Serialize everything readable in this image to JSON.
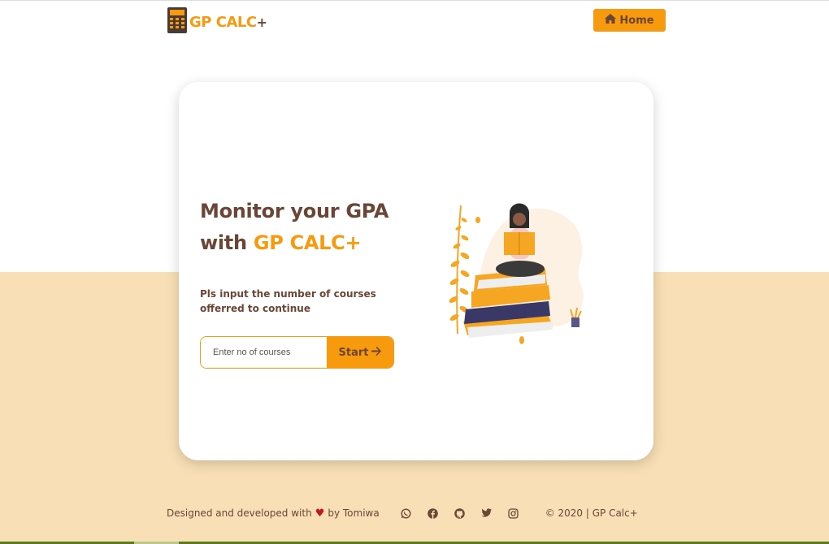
{
  "header": {
    "logo_text": "GP CALC",
    "logo_plus": "+",
    "home_label": "Home"
  },
  "hero": {
    "headline_line1": "Monitor your GPA",
    "headline_with": "with ",
    "headline_brand": "GP CALC+",
    "instruction": "Pls input the number of courses offerred to continue",
    "input_placeholder": "Enter no of courses",
    "input_value": "",
    "start_label": "Start"
  },
  "footer": {
    "credit_prefix": "Designed and developed with",
    "credit_suffix": "by Tomiwa",
    "copyright": "© 2020 | GP Calc+",
    "social_icons": [
      "whatsapp-icon",
      "facebook-icon",
      "github-icon",
      "twitter-icon",
      "instagram-icon"
    ]
  },
  "colors": {
    "accent": "#f79a0d",
    "text_brown": "#6b4535",
    "band": "#f8dfb6",
    "heart": "#c4161c"
  },
  "icons": {
    "logo": "calculator-icon",
    "home": "home-icon",
    "start": "arrow-right-icon"
  }
}
